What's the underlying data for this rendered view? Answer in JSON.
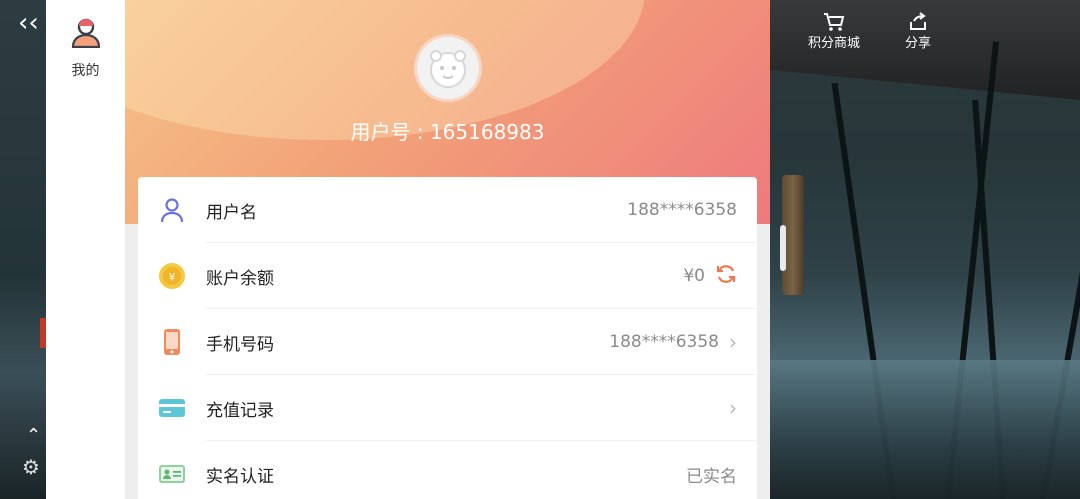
{
  "sidebar": {
    "tab_label": "我的"
  },
  "header": {
    "user_id": "用户号 : 165168983"
  },
  "top_actions": [
    {
      "label": "积分商城",
      "icon": "cart-icon"
    },
    {
      "label": "分享",
      "icon": "share-icon"
    }
  ],
  "rows": [
    {
      "label": "用户名",
      "value": "188****6358",
      "icon": "person-icon"
    },
    {
      "label": "账户余额",
      "value": "¥0",
      "icon": "coin-icon"
    },
    {
      "label": "手机号码",
      "value": "188****6358",
      "icon": "phone-icon"
    },
    {
      "label": "充值记录",
      "value": "",
      "icon": "card-icon"
    },
    {
      "label": "实名认证",
      "value": "已实名",
      "icon": "id-card-icon"
    }
  ],
  "colors": {
    "accent": "#f08a78",
    "sidebar_bg": "#ffffff",
    "card_bg": "#ffffff"
  }
}
